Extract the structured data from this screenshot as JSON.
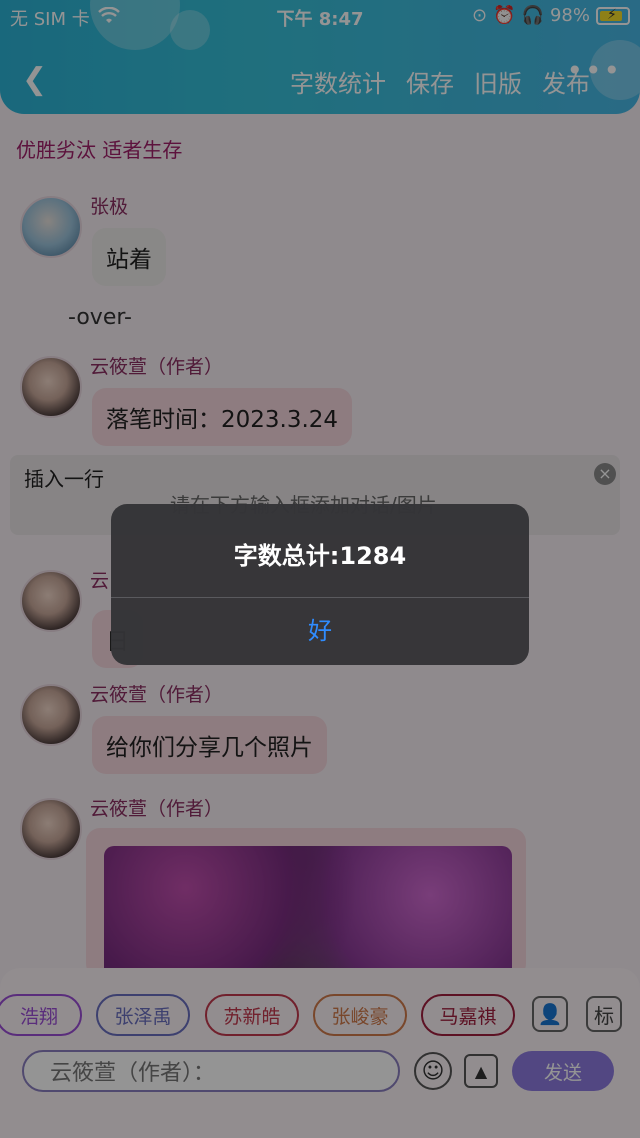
{
  "status_bar": {
    "carrier": "无 SIM 卡",
    "time": "下午 8:47",
    "battery": "98%"
  },
  "nav": {
    "back_icon": "back-arrow-icon",
    "items": [
      "字数统计",
      "保存",
      "旧版",
      "发布"
    ],
    "more": "•••"
  },
  "subtitle": "优胜劣汰 适者生存",
  "messages": [
    {
      "name": "张极",
      "text": "站着"
    },
    {
      "name": "云筱萱（作者）",
      "text": "落笔时间：2023.3.24"
    },
    {
      "name": "云",
      "text": "日"
    },
    {
      "name": "云筱萱（作者）",
      "text": "给你们分享几个照片"
    },
    {
      "name": "云筱萱（作者）",
      "text": ""
    }
  ],
  "over_text": "-over-",
  "insert_panel": {
    "title": "插入一行",
    "hint": "请在下方输入框添加对话/图片",
    "close": "×"
  },
  "chips": [
    {
      "label": "浩翔",
      "color": "#9c4fd6"
    },
    {
      "label": "张泽禹",
      "color": "#6a6fc0"
    },
    {
      "label": "苏新皓",
      "color": "#c33a4f"
    },
    {
      "label": "张峻豪",
      "color": "#d07a4a"
    },
    {
      "label": "马嘉祺",
      "color": "#a0203f"
    }
  ],
  "role_buttons": {
    "person": "👤",
    "label": "标"
  },
  "input": {
    "placeholder": "云筱萱（作者）："
  },
  "send": "发送",
  "alert": {
    "title": "字数总计:1284",
    "ok": "好"
  }
}
